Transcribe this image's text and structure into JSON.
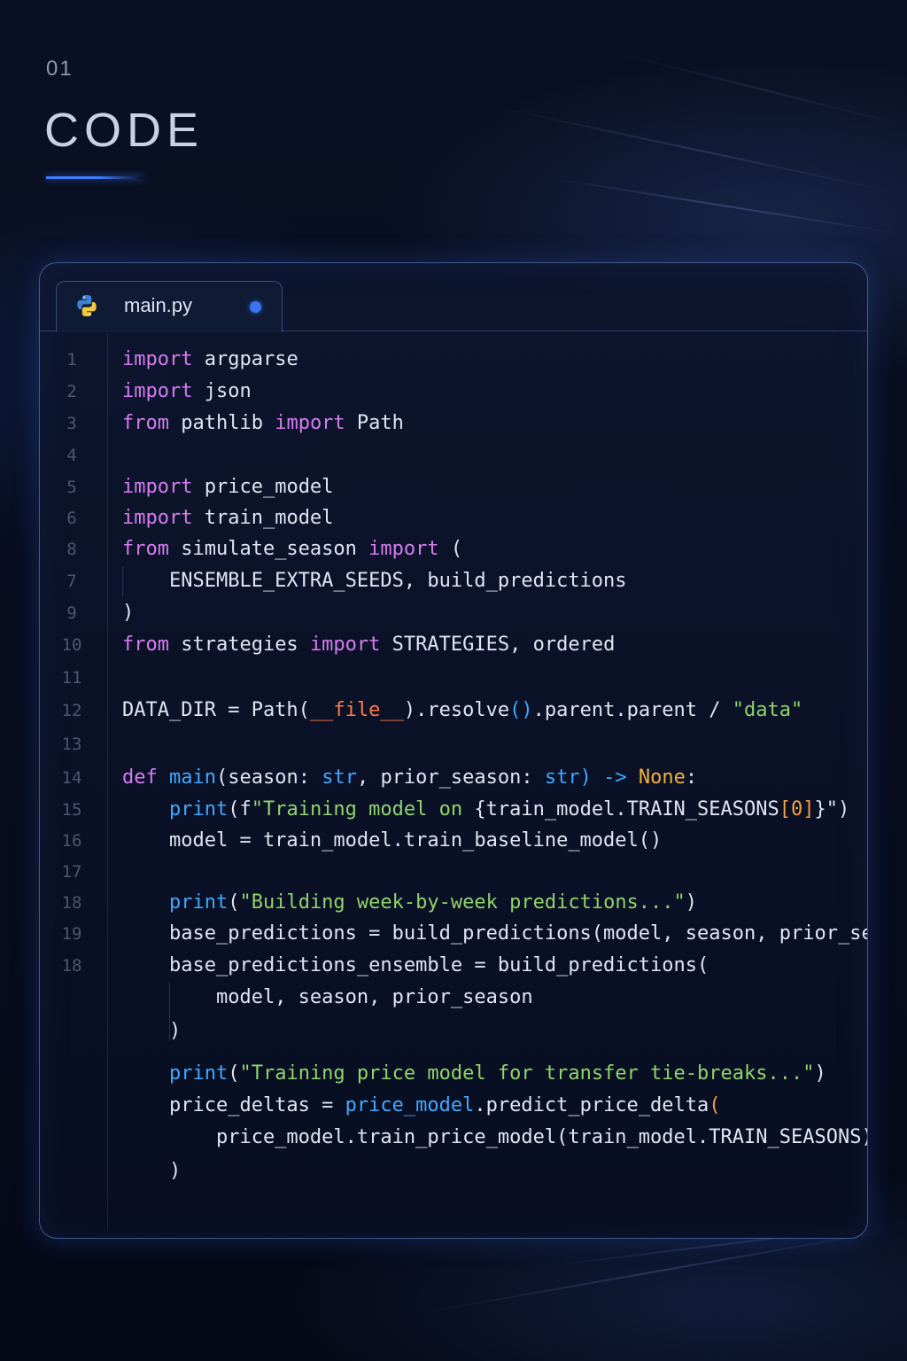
{
  "section": {
    "number": "01",
    "title": "CODE"
  },
  "editor": {
    "tab": {
      "filename": "main.py",
      "icon": "python-icon",
      "modified_indicator_color": "#3d74ef"
    },
    "colors": {
      "keyword": "#d57bf0",
      "function": "#3fa8ff",
      "string": "#8fd46a",
      "number": "#f0a040",
      "dunder": "#ff7a45",
      "type_hint": "#f0b040",
      "text": "#dfe5f2"
    },
    "lines": [
      {
        "num": "1",
        "tokens": [
          {
            "t": "import",
            "c": "kw"
          },
          {
            "t": " argparse"
          }
        ]
      },
      {
        "num": "2",
        "tokens": [
          {
            "t": "import",
            "c": "kw"
          },
          {
            "t": " json"
          }
        ]
      },
      {
        "num": "3",
        "tokens": [
          {
            "t": "from",
            "c": "kw"
          },
          {
            "t": " pathlib "
          },
          {
            "t": "import",
            "c": "kw"
          },
          {
            "t": " Path"
          }
        ]
      },
      {
        "num": "4",
        "tokens": []
      },
      {
        "num": "5",
        "tokens": [
          {
            "t": "import",
            "c": "kw"
          },
          {
            "t": " price_model"
          }
        ]
      },
      {
        "num": "6",
        "tokens": [
          {
            "t": "import",
            "c": "kw"
          },
          {
            "t": " train_model"
          }
        ]
      },
      {
        "num": "8",
        "tokens": [
          {
            "t": "from",
            "c": "kw"
          },
          {
            "t": " simulate_season "
          },
          {
            "t": "import",
            "c": "kw"
          },
          {
            "t": " ("
          }
        ]
      },
      {
        "num": "7",
        "tokens": [
          {
            "t": "    ENSEMBLE_EXTRA_SEEDS, build_predictions"
          }
        ]
      },
      {
        "num": "9",
        "tokens": [
          {
            "t": ")"
          }
        ]
      },
      {
        "num": "10",
        "tokens": [
          {
            "t": "from",
            "c": "kw"
          },
          {
            "t": " strategies "
          },
          {
            "t": "import",
            "c": "kw"
          },
          {
            "t": " STRATEGIES, ordered"
          }
        ]
      },
      {
        "num": "11",
        "tokens": []
      },
      {
        "num": "12",
        "tokens": [
          {
            "t": "DATA_DIR = Path("
          },
          {
            "t": "__file__",
            "c": "dunder"
          },
          {
            "t": ").resolve"
          },
          {
            "t": "()",
            "c": "fn"
          },
          {
            "t": ".parent.parent / "
          },
          {
            "t": "\"data\"",
            "c": "str"
          }
        ]
      },
      {
        "num": "13",
        "tokens": []
      },
      {
        "num": "14",
        "tokens": [
          {
            "t": "def",
            "c": "kw"
          },
          {
            "t": " "
          },
          {
            "t": "main",
            "c": "fn"
          },
          {
            "t": "(season: "
          },
          {
            "t": "str",
            "c": "fn"
          },
          {
            "t": ", prior_season: "
          },
          {
            "t": "str",
            "c": "fn"
          },
          {
            "t": ") -> ",
            "c": "fn"
          },
          {
            "t": "None",
            "c": "typ"
          },
          {
            "t": ":"
          }
        ]
      },
      {
        "num": "15",
        "tokens": [
          {
            "t": "    "
          },
          {
            "t": "print",
            "c": "fn"
          },
          {
            "t": "(f"
          },
          {
            "t": "\"Training model on ",
            "c": "str"
          },
          {
            "t": "{train_model.TRAIN_SEASONS"
          },
          {
            "t": "[0]",
            "c": "num"
          },
          {
            "t": "}\")"
          }
        ]
      },
      {
        "num": "16",
        "tokens": [
          {
            "t": "    model = train_model.train_baseline_model()"
          }
        ]
      },
      {
        "num": "17",
        "tokens": []
      },
      {
        "num": "18",
        "tokens": [
          {
            "t": "    "
          },
          {
            "t": "print",
            "c": "fn"
          },
          {
            "t": "("
          },
          {
            "t": "\"Building week-by-week predictions...\"",
            "c": "str"
          },
          {
            "t": ")"
          }
        ]
      },
      {
        "num": "19",
        "tokens": [
          {
            "t": "    base_predictions = build_predictions(model, season, prior_season)"
          }
        ]
      },
      {
        "num": "18",
        "tokens": [
          {
            "t": "    base_predictions_ensemble = build_predictions("
          }
        ]
      },
      {
        "num": "",
        "tokens": [
          {
            "t": "        model, season, prior_season"
          }
        ]
      },
      {
        "num": "",
        "tokens": [
          {
            "t": "    )"
          }
        ]
      },
      {
        "num": "",
        "tokens": [
          {
            "t": "    "
          },
          {
            "t": "print",
            "c": "fn"
          },
          {
            "t": "("
          },
          {
            "t": "\"Training price model for transfer tie-breaks...\"",
            "c": "str"
          },
          {
            "t": ")"
          }
        ]
      },
      {
        "num": "",
        "tokens": [
          {
            "t": "    price_deltas = "
          },
          {
            "t": "price_model",
            "c": "fn"
          },
          {
            "t": ".predict_price_delta"
          },
          {
            "t": "(",
            "c": "num"
          }
        ]
      },
      {
        "num": "",
        "tokens": [
          {
            "t": "        price_model.train_price_model(train_model.TRAIN_SEASONS), season"
          }
        ]
      },
      {
        "num": "",
        "tokens": [
          {
            "t": "    )"
          }
        ]
      }
    ]
  }
}
